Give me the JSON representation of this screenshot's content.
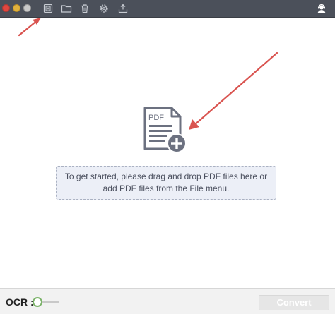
{
  "window": {
    "traffic_lights": [
      "close",
      "minimize",
      "maximize"
    ]
  },
  "toolbar": {
    "icons": [
      "add-file-icon",
      "folder-icon",
      "trash-icon",
      "gear-icon",
      "export-icon"
    ],
    "right_icon": "support-agent-icon"
  },
  "drop_zone": {
    "icon": "pdf-add-icon",
    "pdf_badge": "PDF",
    "instructions": "To get started, please drag and drop PDF files here or add PDF files from the File menu."
  },
  "bottom_bar": {
    "ocr_label": "OCR :",
    "ocr_enabled": false,
    "convert_label": "Convert"
  },
  "colors": {
    "titlebar": "#4b505a",
    "drop_zone_bg": "#eceff7",
    "annotation_arrow": "#d9534f",
    "ocr_accent": "#7cb36a"
  }
}
